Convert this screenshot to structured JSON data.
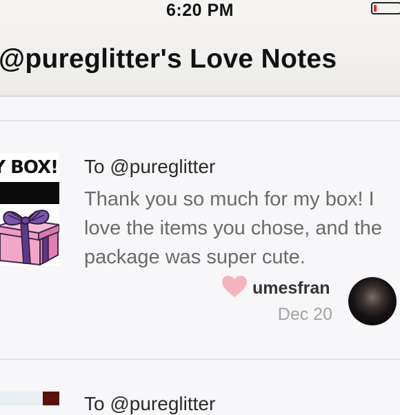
{
  "status_bar": {
    "time": "6:20 PM",
    "battery_level": 0.1,
    "battery_color": "#e5312f"
  },
  "nav": {
    "title": "@pureglitter's Love Notes"
  },
  "notes": [
    {
      "image_caption": "Y BOX!",
      "image_icon": "gift-box-icon",
      "recipient": "To @pureglitter",
      "message": "Thank you so much for my box! I love the items you chose, and the package was super cute.",
      "liked_icon": "heart-icon",
      "like_color": "#f5b3bd",
      "author": "umesfran",
      "date": "Dec 20"
    }
  ],
  "next_note": {
    "recipient": "To @pureglitter"
  }
}
